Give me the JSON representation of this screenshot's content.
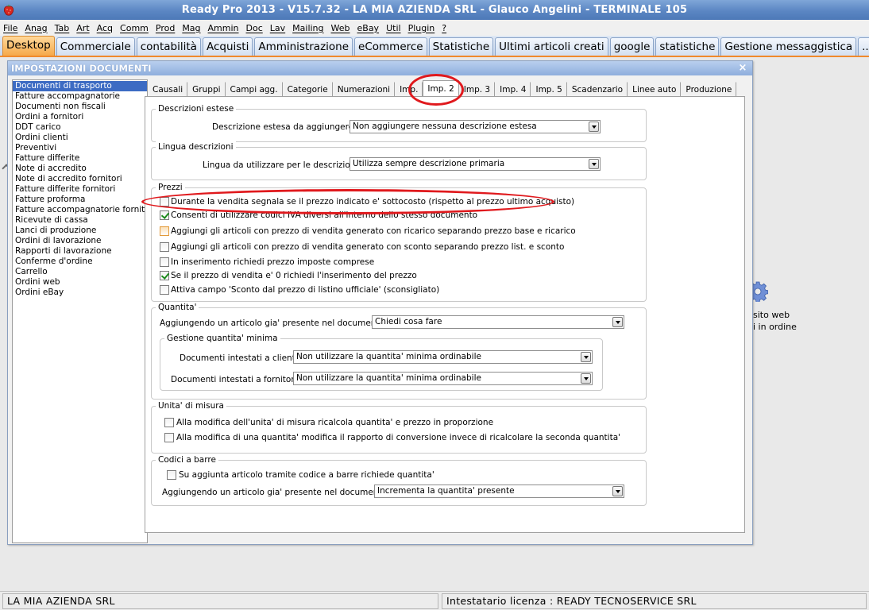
{
  "window": {
    "title": "Ready Pro 2013 - V15.7.32 - LA MIA AZIENDA SRL - Glauco Angelini - TERMINALE 105"
  },
  "menu": [
    "File",
    "Anag",
    "Tab",
    "Art",
    "Acq",
    "Comm",
    "Prod",
    "Mag",
    "Ammin",
    "Doc",
    "Lav",
    "Mailing",
    "Web",
    "eBay",
    "Util",
    "Plugin",
    "?"
  ],
  "modules": [
    "Desktop",
    "Commerciale",
    "contabilità",
    "Acquisti",
    "Amministrazione",
    "eCommerce",
    "Statistiche",
    "Ultimi articoli creati",
    "google",
    "statistiche",
    "Gestione messaggistica",
    "..."
  ],
  "desktop": {
    "shortcut_line1": "sito web",
    "shortcut_line2": "i in ordine"
  },
  "status": {
    "left": "LA MIA AZIENDA SRL",
    "right": "Intestatario licenza : READY TECNOSERVICE SRL"
  },
  "dialog": {
    "title": "IMPOSTAZIONI DOCUMENTI",
    "close": "×",
    "doc_types": [
      "Documenti di trasporto",
      "Fatture accompagnatorie",
      "Documenti non fiscali",
      "Ordini a fornitori",
      "DDT carico",
      "Ordini clienti",
      "Preventivi",
      "Fatture differite",
      "Note di accredito",
      "Note di accredito fornitori",
      "Fatture differite fornitori",
      "Fatture proforma",
      "Fatture accompagnatorie fornito",
      "Ricevute di cassa",
      "Lanci di produzione",
      "Ordini di lavorazione",
      "Rapporti di lavorazione",
      "Conferme d'ordine",
      "Carrello",
      "Ordini web",
      "Ordini eBay"
    ],
    "tabs": [
      "Causali",
      "Gruppi",
      "Campi agg.",
      "Categorie",
      "Numerazioni",
      "Imp.",
      "Imp. 2",
      "Imp. 3",
      "Imp. 4",
      "Imp. 5",
      "Scadenzario",
      "Linee auto",
      "Produzione"
    ],
    "descr_estese": {
      "title": "Descrizioni estese",
      "label": "Descrizione estesa da aggiungere :",
      "value": "Non aggiungere nessuna descrizione estesa"
    },
    "lingua": {
      "title": "Lingua descrizioni",
      "label": "Lingua da utilizzare per le descrizioni :",
      "value": "Utilizza sempre descrizione primaria"
    },
    "prezzi": {
      "title": "Prezzi",
      "opt1": "Durante la vendita segnala se il prezzo indicato e' sottocosto (rispetto al prezzo ultimo acquisto)",
      "opt2": "Consenti di utilizzare codici IVA diversi all'interno dello stesso documento",
      "opt3": "Aggiungi gli articoli con prezzo di vendita generato con ricarico separando prezzo base e ricarico",
      "opt4": "Aggiungi gli articoli con prezzo di vendita generato con sconto separando prezzo list. e sconto",
      "opt5": "In inserimento richiedi prezzo imposte comprese",
      "opt6": "Se il prezzo di vendita e' 0 richiedi l'inserimento del prezzo",
      "opt7": "Attiva campo 'Sconto dal prezzo di listino ufficiale' (sconsigliato)"
    },
    "quantita": {
      "title": "Quantita'",
      "label": "Aggiungendo un articolo gia' presente nel documento :",
      "value": "Chiedi cosa fare",
      "min_title": "Gestione quantita' minima",
      "clienti_label": "Documenti intestati a clienti :",
      "clienti_value": "Non utilizzare la quantita' minima ordinabile",
      "fornitori_label": "Documenti intestati a fornitori :",
      "fornitori_value": "Non utilizzare la quantita' minima ordinabile"
    },
    "unita": {
      "title": "Unita' di misura",
      "opt1": "Alla modifica dell'unita' di misura ricalcola quantita' e prezzo in proporzione",
      "opt2": "Alla modifica di una quantita' modifica il rapporto di conversione invece di ricalcolare la seconda quantita'"
    },
    "barre": {
      "title": "Codici a barre",
      "opt1": "Su aggiunta articolo tramite codice a barre richiede quantita'",
      "label": "Aggiungendo un articolo gia' presente nel documento :",
      "value": "Incrementa la quantita' presente"
    }
  }
}
